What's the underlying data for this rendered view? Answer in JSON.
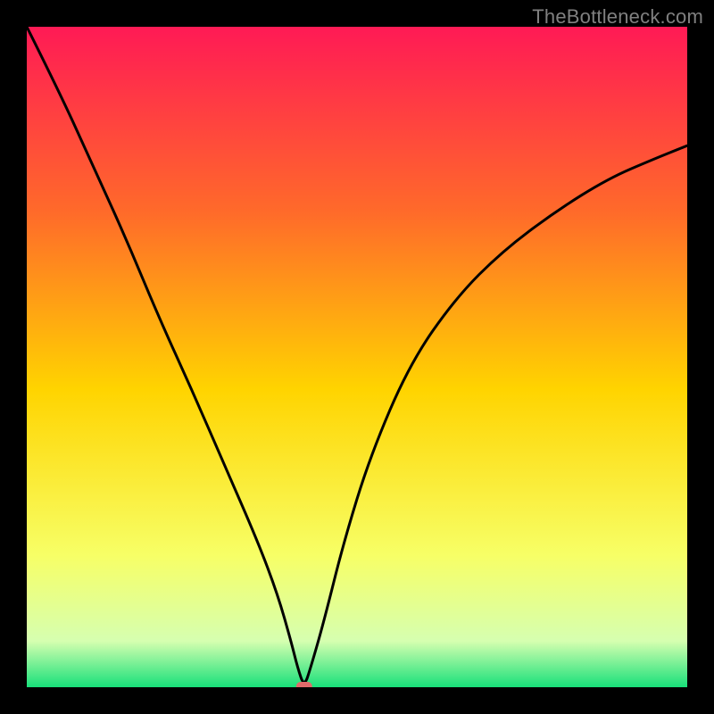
{
  "watermark": "TheBottleneck.com",
  "colors": {
    "background": "#000000",
    "curve": "#000000",
    "watermark_text": "#808080",
    "gradient_top": "#ff1a55",
    "gradient_mid_upper": "#ff6a2a",
    "gradient_mid": "#ffd400",
    "gradient_mid_lower": "#f7ff66",
    "gradient_bottom_pale": "#d6ffb0",
    "gradient_bottom": "#18e07a",
    "marker": "#e06a6a"
  },
  "chart_data": {
    "type": "line",
    "title": "",
    "xlabel": "",
    "ylabel": "",
    "xlim": [
      0,
      100
    ],
    "ylim": [
      0,
      100
    ],
    "grid": false,
    "legend": false,
    "annotations": [],
    "marker": {
      "x": 42,
      "y": 0
    },
    "series": [
      {
        "name": "bottleneck-curve",
        "x": [
          0,
          5,
          10,
          15,
          20,
          25,
          30,
          35,
          38,
          40,
          41,
          42,
          43,
          45,
          48,
          52,
          58,
          65,
          72,
          80,
          88,
          95,
          100
        ],
        "y": [
          100,
          90,
          79,
          68,
          56,
          45,
          33.5,
          22,
          14,
          7,
          3,
          0,
          3,
          10,
          22,
          35,
          49,
          59,
          66,
          72,
          77,
          80,
          82
        ]
      }
    ]
  }
}
